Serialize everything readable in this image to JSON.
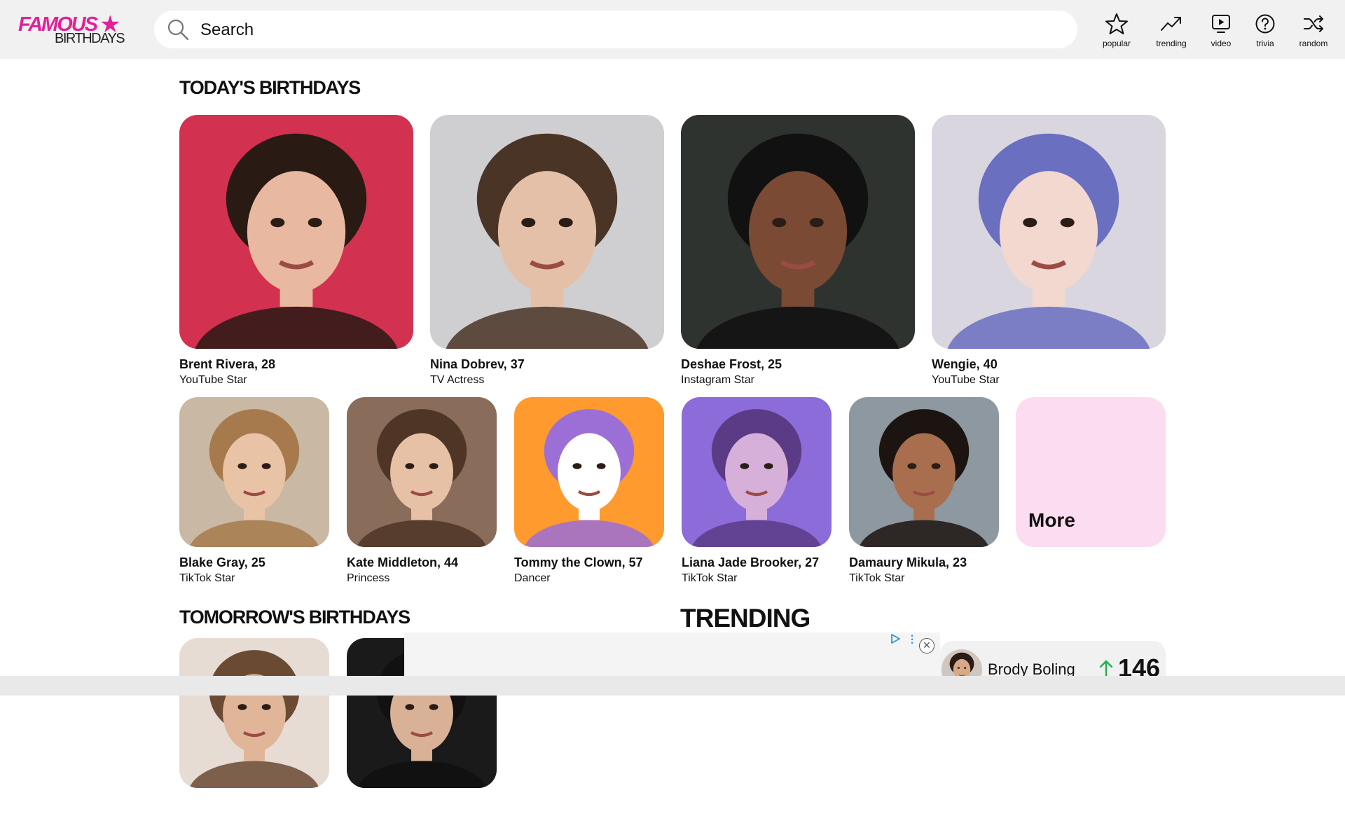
{
  "header": {
    "logo_top": "FAMOUS",
    "logo_bottom": "BIRTHDAYS",
    "search_placeholder": "Search",
    "nav": [
      {
        "label": "popular",
        "icon": "star-icon"
      },
      {
        "label": "trending",
        "icon": "trending-icon"
      },
      {
        "label": "video",
        "icon": "video-icon"
      },
      {
        "label": "trivia",
        "icon": "question-icon"
      },
      {
        "label": "random",
        "icon": "shuffle-icon"
      }
    ]
  },
  "today": {
    "title": "TODAY'S BIRTHDAYS",
    "row1": [
      {
        "name": "Brent Rivera, 28",
        "profession": "YouTube Star",
        "bg": "#d2324f",
        "skin": "#e8b9a0",
        "hair": "#2a1a14"
      },
      {
        "name": "Nina Dobrev, 37",
        "profession": "TV Actress",
        "bg": "#cfcfd2",
        "skin": "#e5c0a8",
        "hair": "#4a3426"
      },
      {
        "name": "Deshae Frost, 25",
        "profession": "Instagram Star",
        "bg": "#2e3330",
        "skin": "#7a4a35",
        "hair": "#111111"
      },
      {
        "name": "Wengie, 40",
        "profession": "YouTube Star",
        "bg": "#d9d6df",
        "skin": "#f2d8cf",
        "hair": "#6a6fc0"
      }
    ],
    "row2": [
      {
        "name": "Blake Gray, 25",
        "profession": "TikTok Star",
        "bg": "#c9b8a4",
        "skin": "#e9c3a6",
        "hair": "#a77a4e"
      },
      {
        "name": "Kate Middleton, 44",
        "profession": "Princess",
        "bg": "#8a6c5a",
        "skin": "#e6c1a5",
        "hair": "#4e3526"
      },
      {
        "name": "Tommy the Clown, 57",
        "profession": "Dancer",
        "bg": "#ff9a2e",
        "skin": "#ffffff",
        "hair": "#9b6fd6"
      },
      {
        "name": "Liana Jade Brooker, 27",
        "profession": "TikTok Star",
        "bg": "#8c6cd8",
        "skin": "#d6b0d8",
        "hair": "#5b3b86"
      },
      {
        "name": "Damaury Mikula, 23",
        "profession": "TikTok Star",
        "bg": "#8e98a0",
        "skin": "#a86e4e",
        "hair": "#1c1410"
      }
    ],
    "more_label": "More"
  },
  "tomorrow": {
    "title": "TOMORROW'S BIRTHDAYS",
    "cards": [
      {
        "bg": "#e6dcd4",
        "skin": "#e1b598",
        "hair": "#6a4a33"
      },
      {
        "bg": "#1a1a1a",
        "skin": "#d9b197",
        "hair": "#111111"
      }
    ]
  },
  "trending": {
    "title": "TRENDING",
    "items": [
      {
        "name": "Brody Boling",
        "rank_change": "146",
        "arrow_color": "#22b04a",
        "skin": "#d8a988",
        "hair": "#2a1c14"
      }
    ]
  },
  "ad": {
    "close_label": "✕",
    "dots_label": "⋮"
  },
  "colors": {
    "brand": "#e0219a",
    "more_bg": "#fcdcf0"
  }
}
